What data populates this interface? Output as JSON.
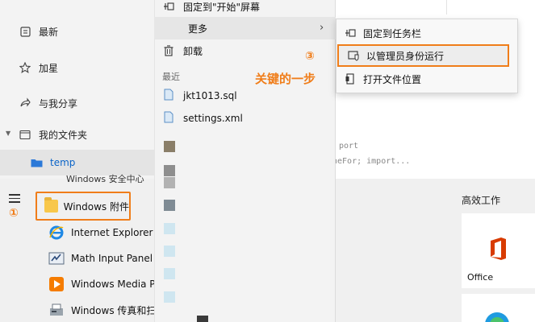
{
  "sidebar": {
    "items": [
      {
        "label": "最新",
        "icon": "clock-icon"
      },
      {
        "label": "加星",
        "icon": "star-icon"
      },
      {
        "label": "与我分享",
        "icon": "share-icon"
      },
      {
        "label": "我的文件夹",
        "icon": "folder-outline-icon"
      },
      {
        "label": "temp",
        "icon": "folder-icon"
      }
    ]
  },
  "context_menu": {
    "pin_start": "固定到\"开始\"屏幕",
    "more": "更多",
    "uninstall": "卸载",
    "recent_header": "最近",
    "recent_files": [
      "jkt1013.sql",
      "settings.xml"
    ]
  },
  "submenu": {
    "pin_taskbar": "固定到任务栏",
    "run_as_admin": "以管理员身份运行",
    "open_location": "打开文件位置"
  },
  "annotations": {
    "step1": "①",
    "step3": "③",
    "key_step": "关键的一步",
    "accent_color": "#f07d19"
  },
  "start_menu": {
    "partial_top": "Windows 安全中心",
    "windows_accessories": "Windows 附件",
    "apps": [
      {
        "label": "Internet Explorer",
        "icon": "ie-icon"
      },
      {
        "label": "Math Input Panel",
        "icon": "math-input-icon"
      },
      {
        "label": "Windows Media Pla",
        "icon": "media-player-icon"
      },
      {
        "label": "Windows 传真和扫描",
        "icon": "fax-scan-icon"
      }
    ],
    "tiles_title": "高效工作",
    "office_tile": "Office"
  },
  "background": {
    "code_line1": "port",
    "code_line2": "heFor; import..."
  }
}
